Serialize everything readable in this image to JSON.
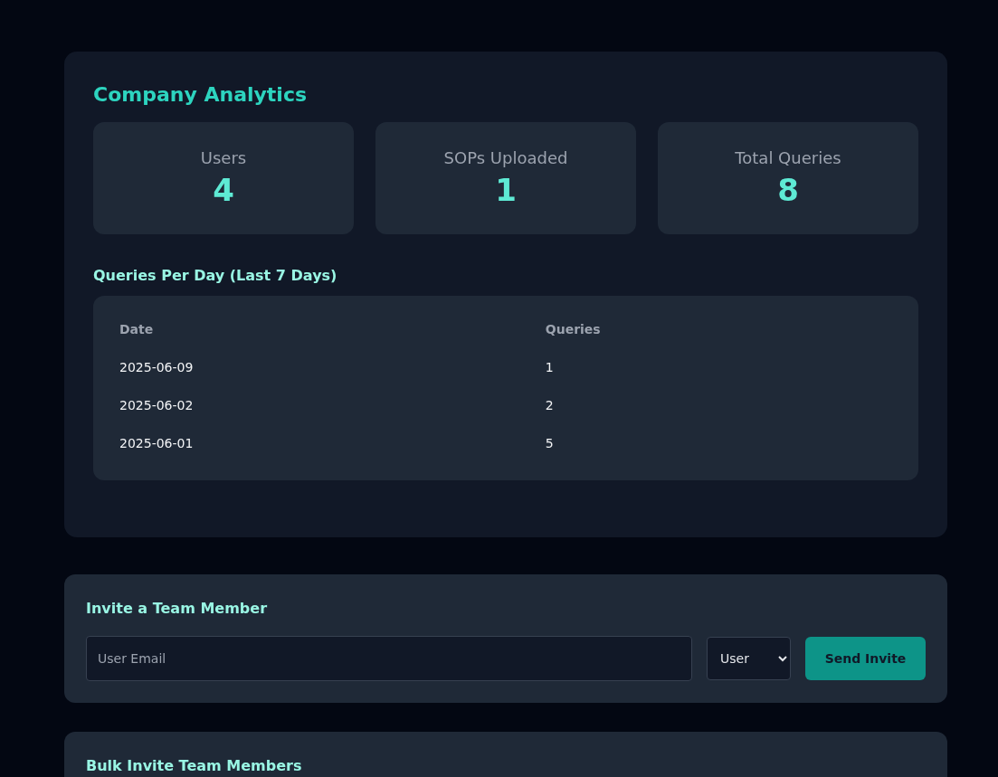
{
  "analytics": {
    "title": "Company Analytics",
    "stats": [
      {
        "label": "Users",
        "value": "4"
      },
      {
        "label": "SOPs Uploaded",
        "value": "1"
      },
      {
        "label": "Total Queries",
        "value": "8"
      }
    ],
    "queries_per_day": {
      "title": "Queries Per Day (Last 7 Days)",
      "columns": [
        "Date",
        "Queries"
      ],
      "rows": [
        [
          "2025-06-09",
          "1"
        ],
        [
          "2025-06-02",
          "2"
        ],
        [
          "2025-06-01",
          "5"
        ]
      ]
    }
  },
  "invite": {
    "title": "Invite a Team Member",
    "email": {
      "placeholder": "User Email"
    },
    "role": "User",
    "button": "Send Invite"
  },
  "bulk_invite": {
    "title": "Bulk Invite Team Members"
  }
}
